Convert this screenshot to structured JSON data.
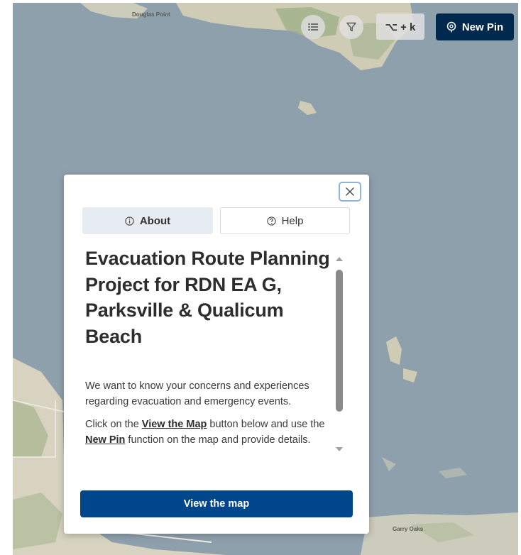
{
  "map": {
    "labels": {
      "top": "Douglas Point",
      "bottom_right": "Garry Oaks"
    }
  },
  "toolbar": {
    "list_icon": "list-icon",
    "filter_icon": "filter-icon",
    "shortcut_label": "⌥ + k",
    "new_pin_icon": "location-pin-icon",
    "new_pin_label": "New Pin"
  },
  "modal": {
    "close_icon": "close-icon",
    "tabs": [
      {
        "icon": "info-icon",
        "label": "About",
        "selected": true
      },
      {
        "icon": "help-icon",
        "label": "Help",
        "selected": false
      }
    ],
    "title": "Evacuation Route Planning Project for RDN EA G, Parksville & Qualicum Beach",
    "paragraph1": "We want to know your concerns and experiences regarding evacuation and emergency events.",
    "paragraph2": {
      "part1": "Click on the ",
      "link1": "View the Map",
      "part2": " button below and use the ",
      "link2": "New Pin",
      "part3": " function on the map and provide details."
    },
    "button_label": "View the map"
  },
  "colors": {
    "water": "#8fa0ad",
    "land": "#d9d6c4",
    "primary_dark": "#00294d",
    "primary": "#00468b",
    "tab_selected_bg": "#e6ecf1"
  }
}
